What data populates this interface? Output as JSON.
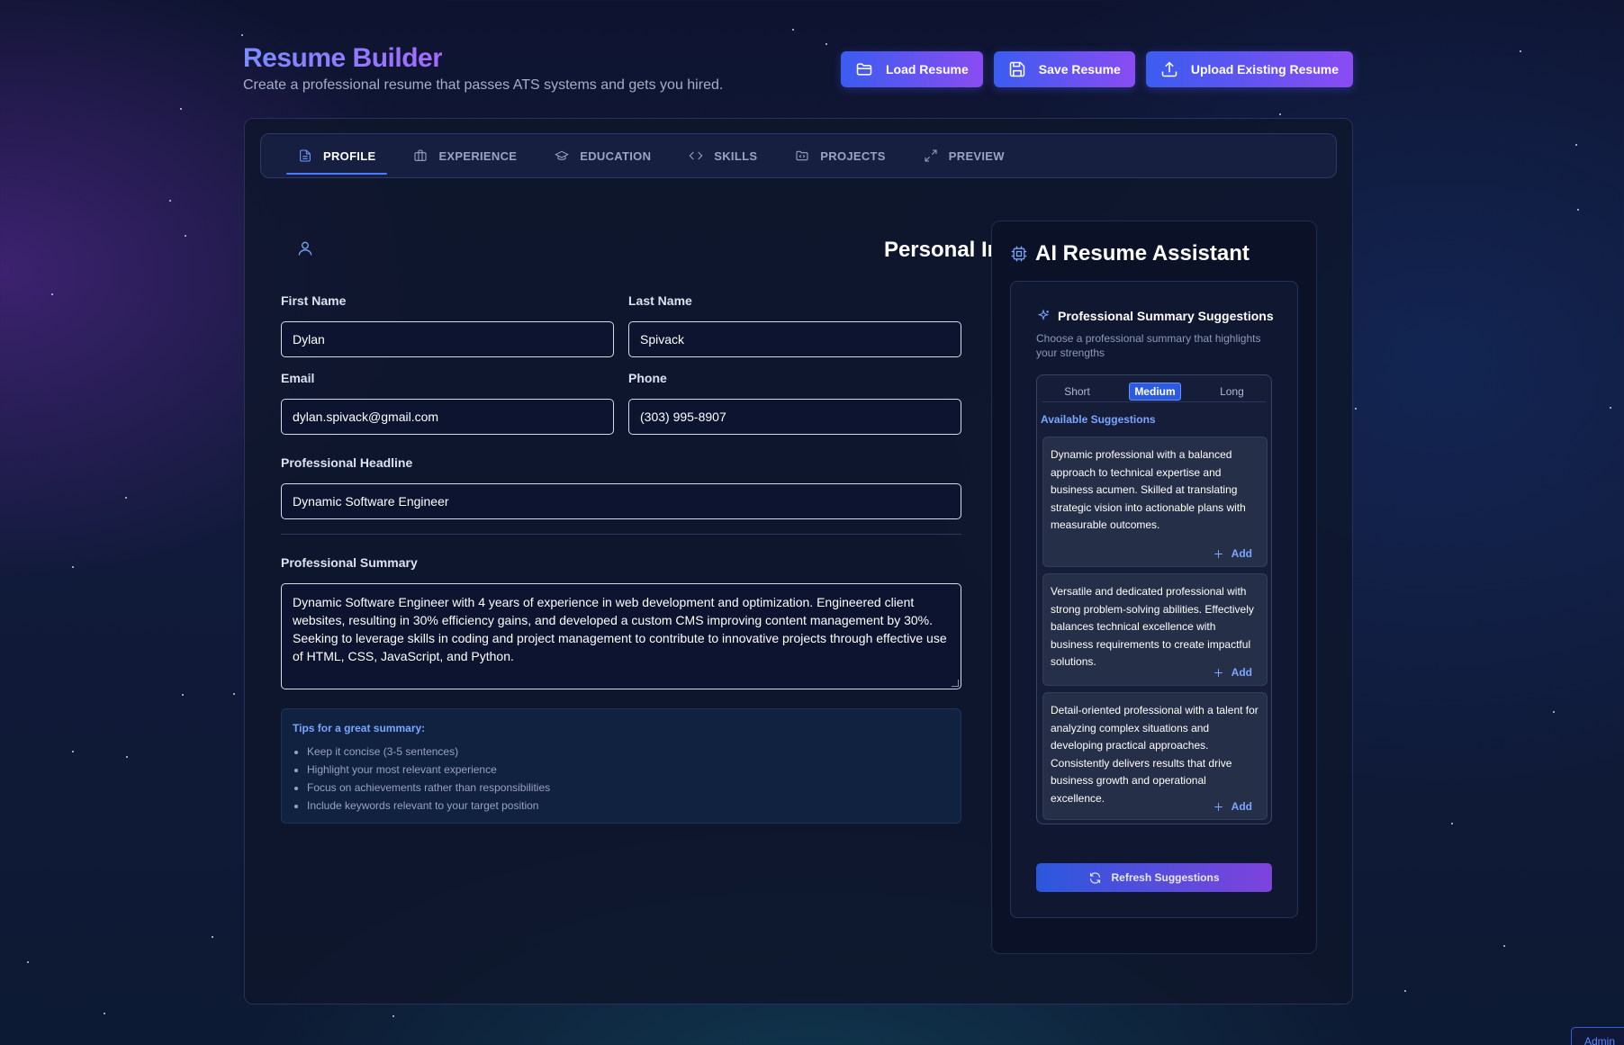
{
  "header": {
    "title": "Resume Builder",
    "subtitle": "Create a professional resume that passes ATS systems and gets you hired.",
    "actions": [
      {
        "label": "Load Resume",
        "icon": "folder-icon"
      },
      {
        "label": "Save Resume",
        "icon": "save-icon"
      },
      {
        "label": "Upload Existing Resume",
        "icon": "upload-icon"
      }
    ]
  },
  "tabs": [
    {
      "label": "PROFILE",
      "icon": "document-icon",
      "active": true
    },
    {
      "label": "EXPERIENCE",
      "icon": "briefcase-icon",
      "active": false
    },
    {
      "label": "EDUCATION",
      "icon": "graduation-cap-icon",
      "active": false
    },
    {
      "label": "SKILLS",
      "icon": "code-icon",
      "active": false
    },
    {
      "label": "PROJECTS",
      "icon": "folder-code-icon",
      "active": false
    },
    {
      "label": "PREVIEW",
      "icon": "expand-icon",
      "active": false
    }
  ],
  "profile": {
    "section_title": "Personal Information",
    "first_name": {
      "label": "First Name",
      "value": "Dylan"
    },
    "last_name": {
      "label": "Last Name",
      "value": "Spivack"
    },
    "email": {
      "label": "Email",
      "value": "dylan.spivack@gmail.com"
    },
    "phone": {
      "label": "Phone",
      "value": "(303) 995-8907"
    },
    "headline": {
      "label": "Professional Headline",
      "value": "Dynamic Software Engineer"
    },
    "summary": {
      "label": "Professional Summary",
      "value": "Dynamic Software Engineer with 4 years of experience in web development and optimization. Engineered client websites, resulting in 30% efficiency gains, and developed a custom CMS improving content management by 30%. Seeking to leverage skills in coding and project management to contribute to innovative projects through effective use of HTML, CSS, JavaScript, and Python."
    },
    "tips": {
      "title": "Tips for a great summary:",
      "items": [
        "Keep it concise (3-5 sentences)",
        "Highlight your most relevant experience",
        "Focus on achievements rather than responsibilities",
        "Include keywords relevant to your target position"
      ]
    }
  },
  "assistant": {
    "title": "AI Resume Assistant",
    "suggestions_title": "Professional Summary Suggestions",
    "suggestions_desc": "Choose a professional summary that highlights your strengths",
    "length_tabs": [
      {
        "label": "Short",
        "active": false
      },
      {
        "label": "Medium",
        "active": true
      },
      {
        "label": "Long",
        "active": false
      }
    ],
    "available_label": "Available Suggestions",
    "suggestions": [
      {
        "text": "Dynamic professional with a balanced approach to technical expertise and business acumen. Skilled at translating strategic vision into actionable plans with measurable outcomes.",
        "add_label": "Add"
      },
      {
        "text": "Versatile and dedicated professional with strong problem-solving abilities. Effectively balances technical excellence with business requirements to create impactful solutions.",
        "add_label": "Add"
      },
      {
        "text": "Detail-oriented professional with a talent for analyzing complex situations and developing practical approaches. Consistently delivers results that drive business growth and operational excellence.",
        "add_label": "Add"
      }
    ],
    "refresh_label": "Refresh Suggestions"
  },
  "admin_label": "Admin",
  "colors": {
    "accent": "#4a7cff",
    "gradient_start": "#3b5cf0",
    "gradient_end": "#8a4cf2"
  }
}
